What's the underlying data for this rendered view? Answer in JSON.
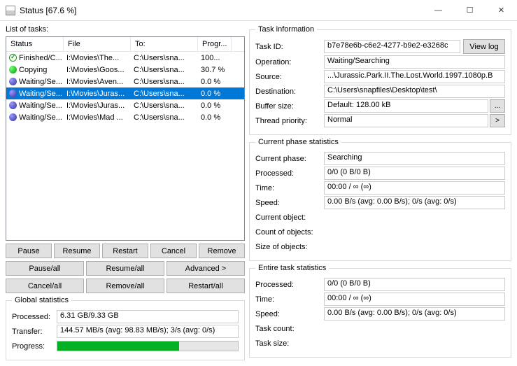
{
  "window": {
    "title": "Status [67.6 %]"
  },
  "leftLabel": "List of tasks:",
  "columns": {
    "status": "Status",
    "file": "File",
    "to": "To:",
    "prog": "Progr..."
  },
  "tasks": [
    {
      "icon": "finished",
      "status": "Finished/C...",
      "file": "I:\\Movies\\The...",
      "to": "C:\\Users\\sna...",
      "prog": "100..."
    },
    {
      "icon": "copying",
      "status": "Copying",
      "file": "I:\\Movies\\Goos...",
      "to": "C:\\Users\\sna...",
      "prog": "30.7 %"
    },
    {
      "icon": "waiting",
      "status": "Waiting/Se...",
      "file": "I:\\Movies\\Aven...",
      "to": "C:\\Users\\sna...",
      "prog": "0.0 %"
    },
    {
      "icon": "waiting",
      "status": "Waiting/Se...",
      "file": "I:\\Movies\\Juras...",
      "to": "C:\\Users\\sna...",
      "prog": "0.0 %",
      "selected": true
    },
    {
      "icon": "waiting",
      "status": "Waiting/Se...",
      "file": "I:\\Movies\\Juras...",
      "to": "C:\\Users\\sna...",
      "prog": "0.0 %"
    },
    {
      "icon": "waiting",
      "status": "Waiting/Se...",
      "file": "I:\\Movies\\Mad ...",
      "to": "C:\\Users\\sna...",
      "prog": "0.0 %"
    }
  ],
  "buttons": {
    "pause": "Pause",
    "resume": "Resume",
    "restart": "Restart",
    "cancel": "Cancel",
    "remove": "Remove",
    "pauseAll": "Pause/all",
    "resumeAll": "Resume/all",
    "advanced": "Advanced >",
    "cancelAll": "Cancel/all",
    "removeAll": "Remove/all",
    "restartAll": "Restart/all",
    "viewLog": "View log"
  },
  "global": {
    "legend": "Global statistics",
    "processedLabel": "Processed:",
    "processed": "6.31 GB/9.33 GB",
    "transferLabel": "Transfer:",
    "transfer": "144.57 MB/s (avg: 98.83 MB/s); 3/s (avg: 0/s)",
    "progressLabel": "Progress:",
    "progressPct": 67.6
  },
  "taskInfo": {
    "legend": "Task information",
    "idLabel": "Task ID:",
    "id": "b7e78e6b-c6e2-4277-b9e2-e3268c",
    "opLabel": "Operation:",
    "op": "Waiting/Searching",
    "srcLabel": "Source:",
    "src": "...\\Jurassic.Park.II.The.Lost.World.1997.1080p.B",
    "dstLabel": "Destination:",
    "dst": "C:\\Users\\snapfiles\\Desktop\\test\\",
    "bufLabel": "Buffer size:",
    "buf": "Default: 128.00 kB",
    "prioLabel": "Thread priority:",
    "prio": "Normal"
  },
  "phase": {
    "legend": "Current phase statistics",
    "phaseLabel": "Current phase:",
    "phase": "Searching",
    "processedLabel": "Processed:",
    "processed": "0/0 (0 B/0 B)",
    "timeLabel": "Time:",
    "time": "00:00 / ∞ (∞)",
    "speedLabel": "Speed:",
    "speed": "0.00 B/s (avg: 0.00 B/s); 0/s (avg: 0/s)",
    "curObjLabel": "Current object:",
    "countLabel": "Count of objects:",
    "sizeLabel": "Size of objects:"
  },
  "entire": {
    "legend": "Entire task statistics",
    "processedLabel": "Processed:",
    "processed": "0/0 (0 B/0 B)",
    "timeLabel": "Time:",
    "time": "00:00 / ∞ (∞)",
    "speedLabel": "Speed:",
    "speed": "0.00 B/s (avg: 0.00 B/s); 0/s (avg: 0/s)",
    "taskCountLabel": "Task count:",
    "taskSizeLabel": "Task size:"
  }
}
